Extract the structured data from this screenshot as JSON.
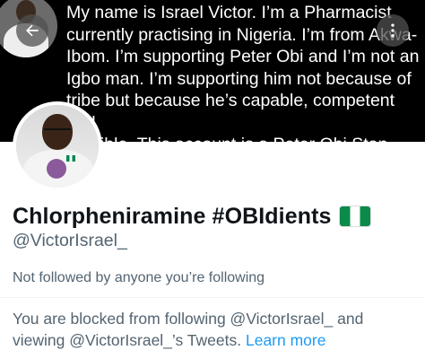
{
  "header": {
    "bio_banner_text": "My name is Israel Victor. I’m a Pharmacist\ncurrently practising in Nigeria. I’m from Akwa-\nIbom. I’m supporting Peter Obi and I’m not an\nIgbo man. I’m supporting him not because of\ntribe but because he’s capable, competent and\ncredible. This account is a Peter Obi Stan\naccount! 📌",
    "back_icon": "arrow-left-icon",
    "more_icon": "vertical-dots-icon"
  },
  "profile": {
    "display_name": "Chlorpheniramine #OBIdients",
    "flag_emoji": "Nigeria flag",
    "handle": "@VictorIsrael_",
    "followed_by": "Not followed by anyone you’re following"
  },
  "blocked_notice": {
    "text": "You are blocked from following @VictorIsrael_ and viewing @VictorIsrael_’s Tweets.",
    "link_label": "Learn more"
  },
  "colors": {
    "link": "#1d9bf0",
    "secondary_text": "#536471",
    "primary_text": "#0f1419"
  }
}
